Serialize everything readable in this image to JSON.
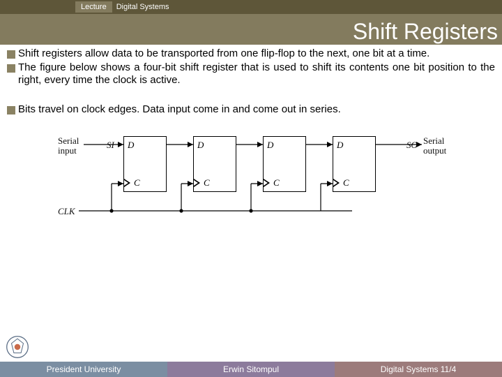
{
  "header": {
    "lecture": "Lecture",
    "course": "Digital Systems",
    "title": "Shift Registers"
  },
  "bullets": [
    "Shift registers allow data to be transported from one flip-flop to the next, one bit at a time.",
    "The figure below shows a four-bit shift register that is used to shift its contents one bit position to the right, every time the clock is active.",
    "Bits travel on clock edges. Data input come in and come out in series."
  ],
  "figure": {
    "serial_input_a": "Serial",
    "serial_input_b": "input",
    "serial_output_a": "Serial",
    "serial_output_b": "output",
    "si": "SI",
    "so": "SO",
    "clk": "CLK",
    "d": "D",
    "c": "C"
  },
  "footer": {
    "left": "President University",
    "center": "Erwin Sitompul",
    "right": "Digital Systems 11/4"
  }
}
